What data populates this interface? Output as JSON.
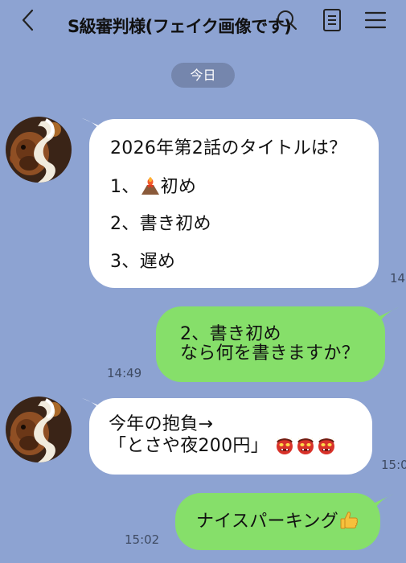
{
  "header": {
    "title": "S級審判様(フェイク画像です)",
    "back_icon": "chevron-left-icon",
    "search_icon": "search-icon",
    "note_icon": "note-icon",
    "menu_icon": "menu-icon"
  },
  "date_divider": "今日",
  "messages": [
    {
      "side": "left",
      "lines": [
        "2026年第2話のタイトルは？",
        "1、",
        "初め",
        "2、書き初め",
        "3、遅め"
      ],
      "time": "14"
    },
    {
      "side": "right",
      "lines": [
        "2、書き初め",
        "なら何を書きますか？"
      ],
      "time": "14:49"
    },
    {
      "side": "left",
      "lines": [
        "今年の抱負→",
        "「とさや夜200円」"
      ],
      "time": "15:0"
    },
    {
      "side": "right",
      "lines": [
        "ナイスパーキング"
      ],
      "time": "15:02"
    }
  ],
  "colors": {
    "background": "#8da3d2",
    "incoming_bubble": "#ffffff",
    "outgoing_bubble": "#86df6a",
    "date_pill": "#7586ad"
  }
}
